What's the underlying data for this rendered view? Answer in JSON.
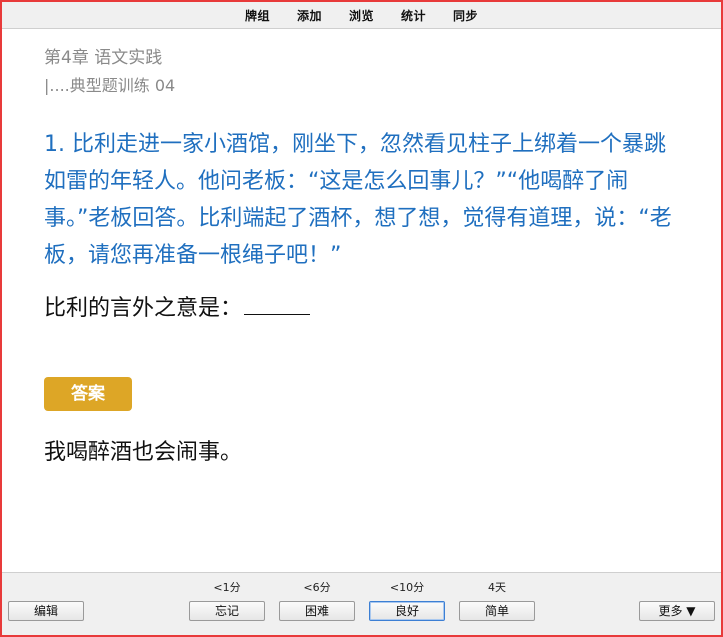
{
  "menu": {
    "decks": "牌组",
    "add": "添加",
    "browse": "浏览",
    "stats": "统计",
    "sync": "同步"
  },
  "card": {
    "chapter": "第4章 语文实践",
    "subsection": "|....典型题训练 04",
    "question": "1. 比利走进一家小酒馆，刚坐下，忽然看见柱子上绑着一个暴跳如雷的年轻人。他问老板：“这是怎么回事儿？”“他喝醉了闹事。”老板回答。比利端起了酒杯，想了想，觉得有道理，说：“老板，请您再准备一根绳子吧！”",
    "prompt": "比利的言外之意是：",
    "answer_label": "答案",
    "answer": "我喝醉酒也会闹事。"
  },
  "bottom": {
    "edit_label": "编辑",
    "more_label": "更多 ▼",
    "buttons": [
      {
        "interval": "<1分",
        "label": "忘记"
      },
      {
        "interval": "<6分",
        "label": "困难"
      },
      {
        "interval": "<10分",
        "label": "良好"
      },
      {
        "interval": "4天",
        "label": "简单"
      }
    ]
  },
  "colors": {
    "frame": "#e83a3a",
    "question_text": "#1f6fbf",
    "answer_badge": "#dda626"
  }
}
